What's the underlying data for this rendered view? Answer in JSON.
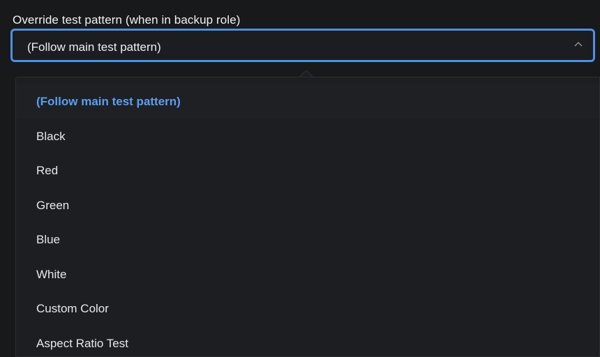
{
  "field": {
    "label": "Override test pattern (when in backup role)",
    "value": "(Follow main test pattern)"
  },
  "dropdown": {
    "options": [
      "(Follow main test pattern)",
      "Black",
      "Red",
      "Green",
      "Blue",
      "White",
      "Custom Color",
      "Aspect Ratio Test"
    ],
    "selected_index": 0
  },
  "colors": {
    "accent": "#4f8fe3",
    "selected_text": "#5c9ef0",
    "background": "#18191b",
    "panel": "#1c1e21"
  },
  "icons": {
    "select_toggle": "chevron-up-icon"
  }
}
